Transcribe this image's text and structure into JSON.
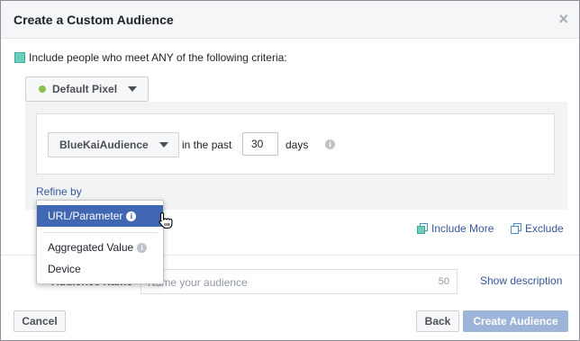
{
  "dialog": {
    "title": "Create a Custom Audience",
    "close_glyph": "×"
  },
  "criteria": {
    "text": "Include people who meet ANY of the following criteria:",
    "swatch_color": "#6fcdbd"
  },
  "pixel": {
    "label": "Default Pixel",
    "status_color": "#8ac14d"
  },
  "rule": {
    "audience_label": "BlueKaiAudience",
    "in_past_text": "in the past",
    "days_value": "30",
    "days_label": "days",
    "refine_label": "Refine by"
  },
  "refine_menu": {
    "items": [
      {
        "label": "URL/Parameter",
        "selected": true,
        "has_info": true
      },
      {
        "label": "Aggregated Value",
        "selected": false,
        "has_info": true
      },
      {
        "label": "Device",
        "selected": false,
        "has_info": false
      }
    ]
  },
  "actions": {
    "include_more": "Include More",
    "exclude": "Exclude"
  },
  "audience_name": {
    "label": "Audience Name",
    "placeholder": "Name your audience",
    "char_count": "50",
    "show_description": "Show description"
  },
  "footer": {
    "cancel": "Cancel",
    "back": "Back",
    "create": "Create Audience"
  },
  "colors": {
    "link": "#365899",
    "selected_item": "#4267b2",
    "create_disabled": "#9cb4d8"
  }
}
